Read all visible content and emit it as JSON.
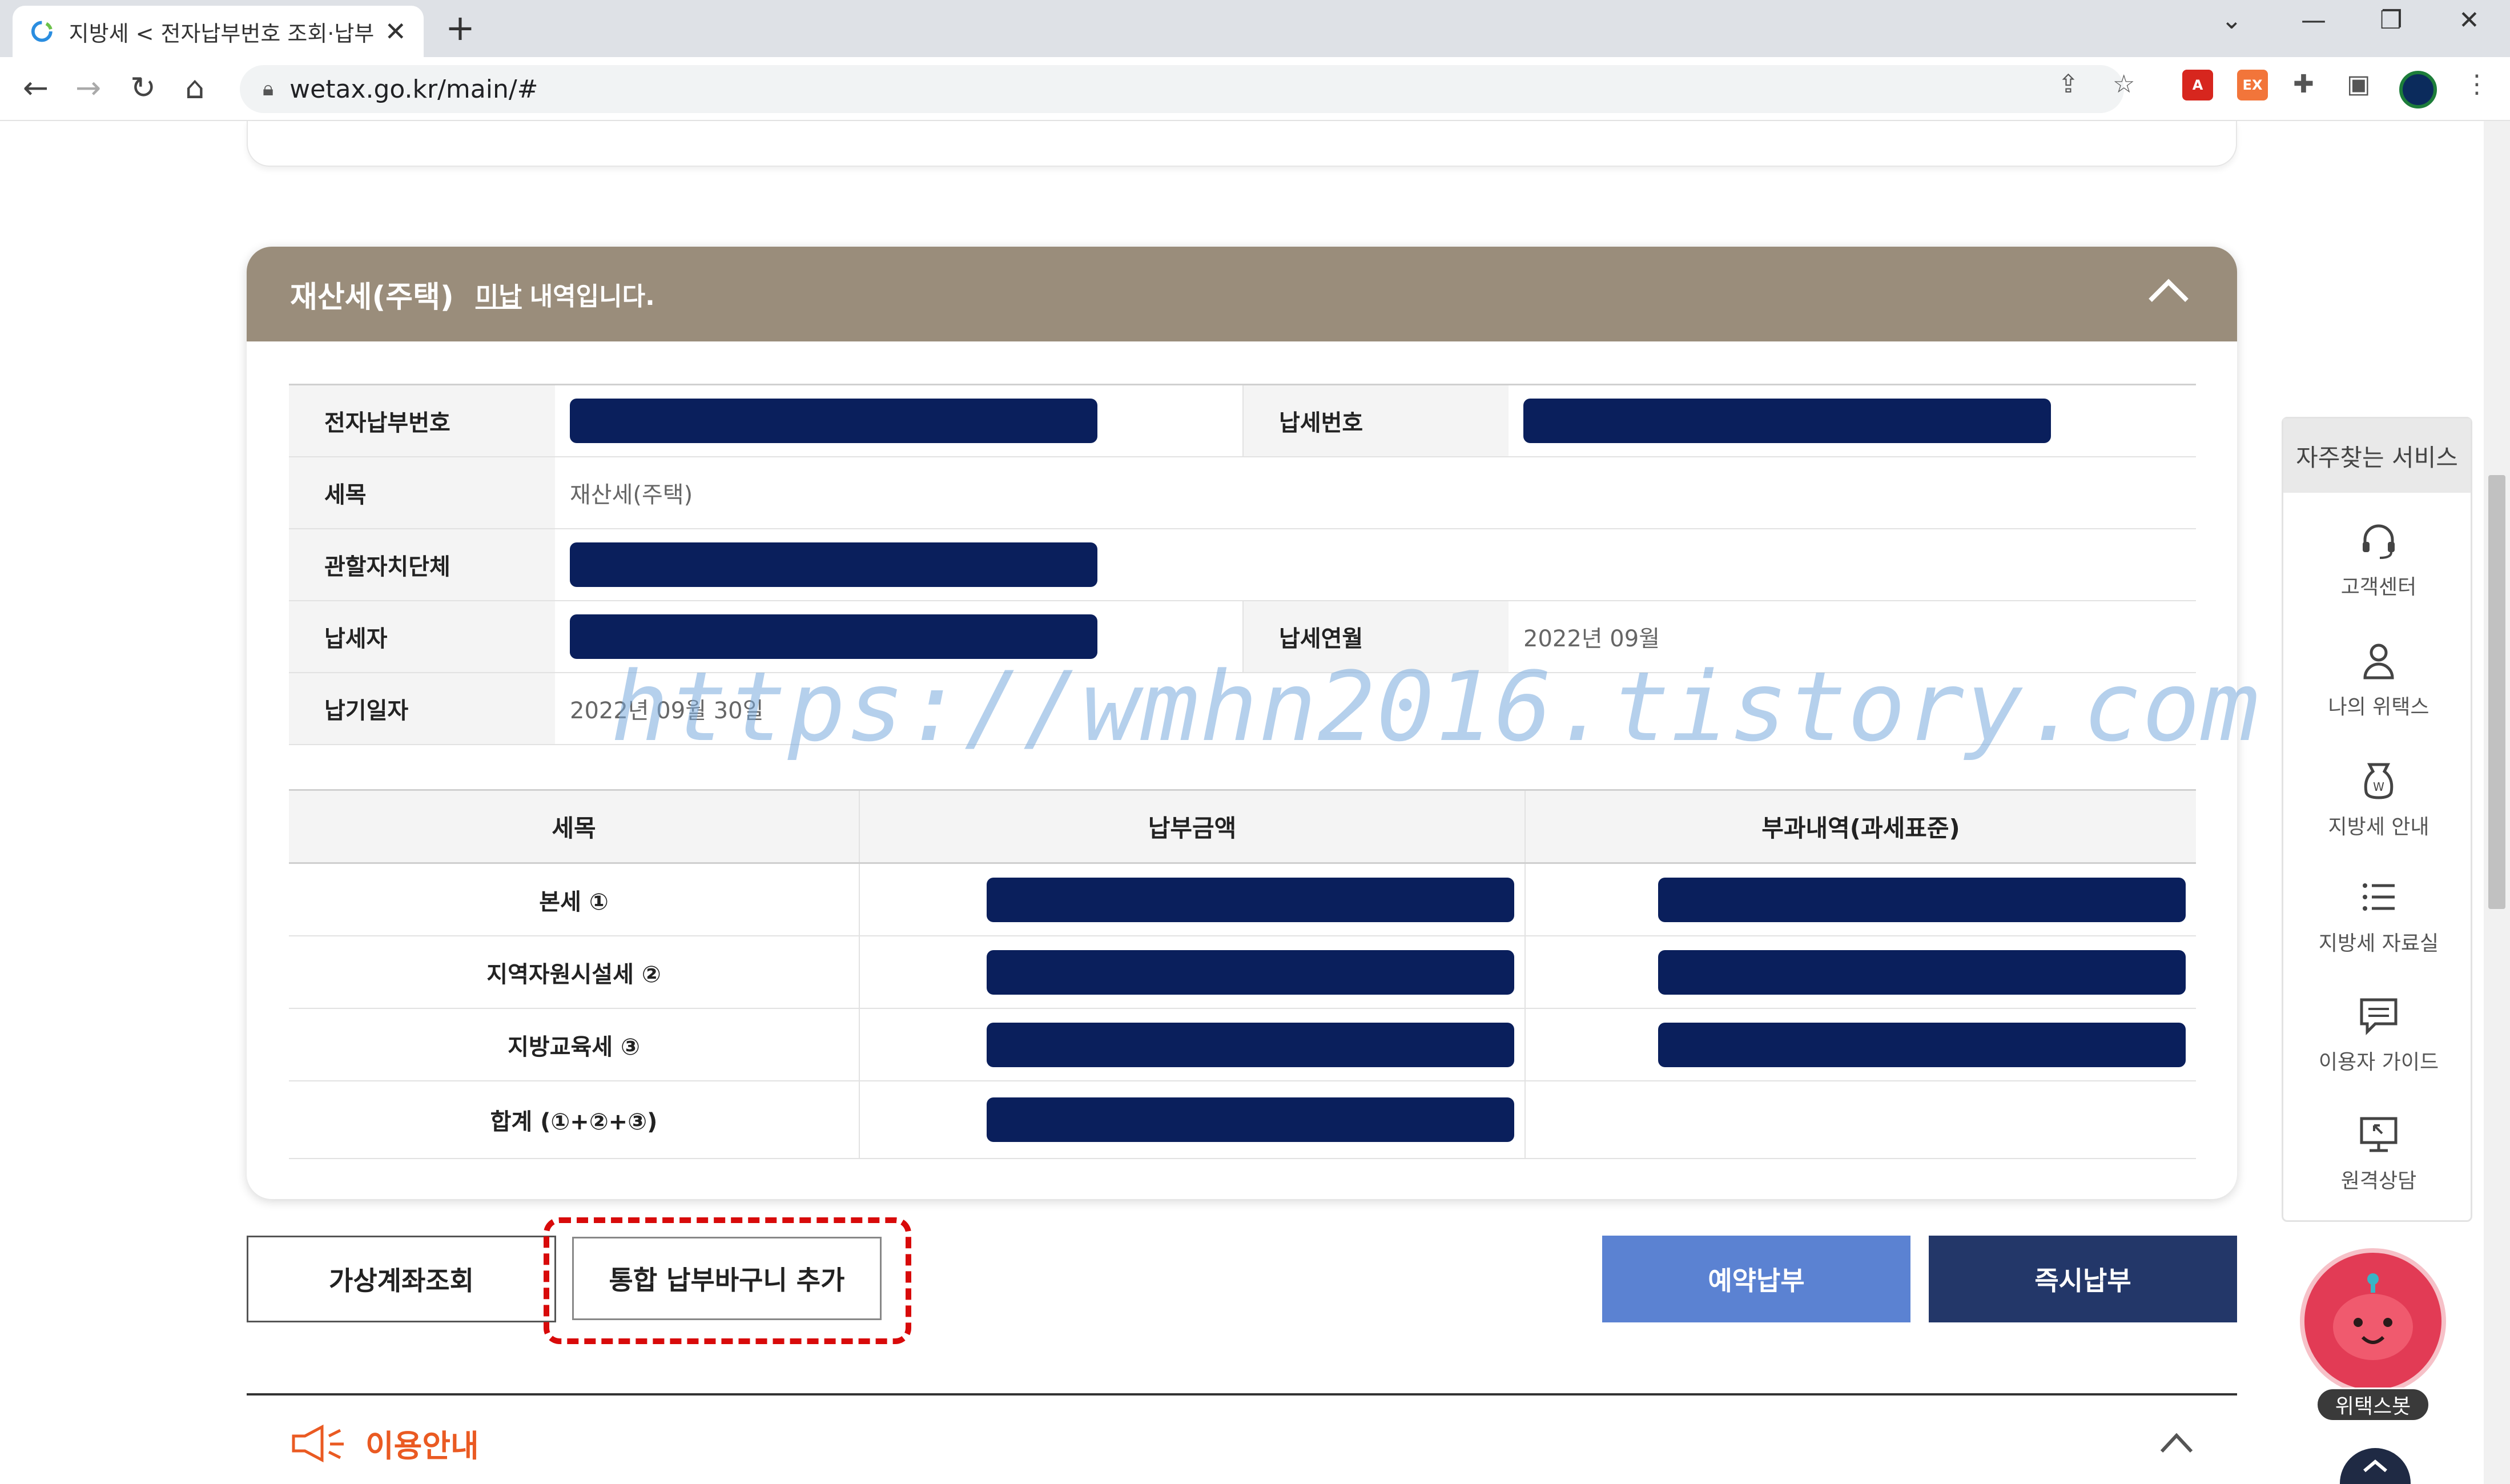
{
  "browser": {
    "tab_title": "지방세 < 전자납부번호 조회·납부",
    "url": "wetax.go.kr/main/#",
    "ext_ex_label": "EX"
  },
  "card": {
    "title": "재산세(주택)",
    "status": "미납",
    "subtitle": "내역입니다.",
    "header_color": "#9a8d7b"
  },
  "info_table": {
    "e_payment_no_label": "전자납부번호",
    "tax_no_label": "납세번호",
    "tax_item_label": "세목",
    "tax_item_value": "재산세(주택)",
    "jurisdiction_label": "관할자치단체",
    "taxpayer_label": "납세자",
    "tax_month_label": "납세연월",
    "tax_month_value": "2022년 09월",
    "due_date_label": "납기일자",
    "due_date_value": "2022년 09월 30일"
  },
  "tax_table": {
    "headers": [
      "세목",
      "납부금액",
      "부과내역(과세표준)"
    ],
    "rows": [
      {
        "label": "본세 ①"
      },
      {
        "label": "지역자원시설세 ②"
      },
      {
        "label": "지방교육세 ③"
      },
      {
        "label": "합계 (①+②+③)"
      }
    ]
  },
  "watermark": "https://wmhn2016.tistory.com",
  "buttons": {
    "virtual_account": "가상계좌조회",
    "add_to_basket": "통합 납부바구니 추가",
    "reserve_payment": "예약납부",
    "instant_payment": "즉시납부"
  },
  "guide": {
    "label": "이용안내"
  },
  "quick_services": {
    "title": "자주찾는 서비스",
    "items": [
      {
        "label": "고객센터",
        "icon": "headset-icon"
      },
      {
        "label": "나의 위택스",
        "icon": "person-icon"
      },
      {
        "label": "지방세 안내",
        "icon": "tax-guide-icon"
      },
      {
        "label": "지방세 자료실",
        "icon": "list-icon"
      },
      {
        "label": "이용자 가이드",
        "icon": "chat-icon"
      },
      {
        "label": "원격상담",
        "icon": "monitor-icon"
      }
    ]
  },
  "chatbot": {
    "label": "위택스봇"
  },
  "colors": {
    "redaction": "#0a1f5c",
    "highlight": "#d80a0a",
    "reserve_button": "#5b82d2",
    "pay_button": "#233769",
    "guide_accent": "#ea5a22"
  }
}
